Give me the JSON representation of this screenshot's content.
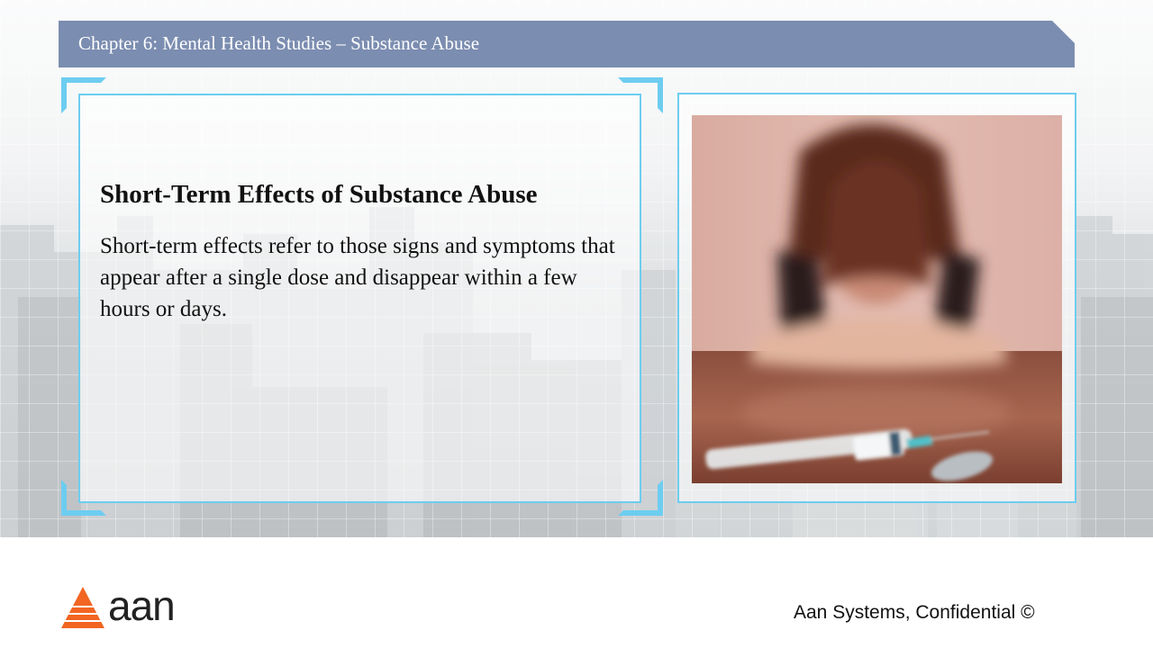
{
  "header": {
    "title": "Chapter 6: Mental Health Studies – Substance Abuse"
  },
  "content": {
    "heading": "Short-Term Effects of Substance Abuse",
    "body": "Short-term effects refer to those signs and symptoms that appear after a single dose and disappear within a few hours or days."
  },
  "footer": {
    "logo_text": "aan",
    "confidential": "Aan Systems, Confidential ©"
  },
  "colors": {
    "header_bar": "#7b8db0",
    "frame_accent": "#6dcdf0",
    "logo_orange": "#f26522"
  },
  "icons": {
    "logo": "aan-triangle-logo",
    "photo": "person-with-syringe-photo"
  }
}
